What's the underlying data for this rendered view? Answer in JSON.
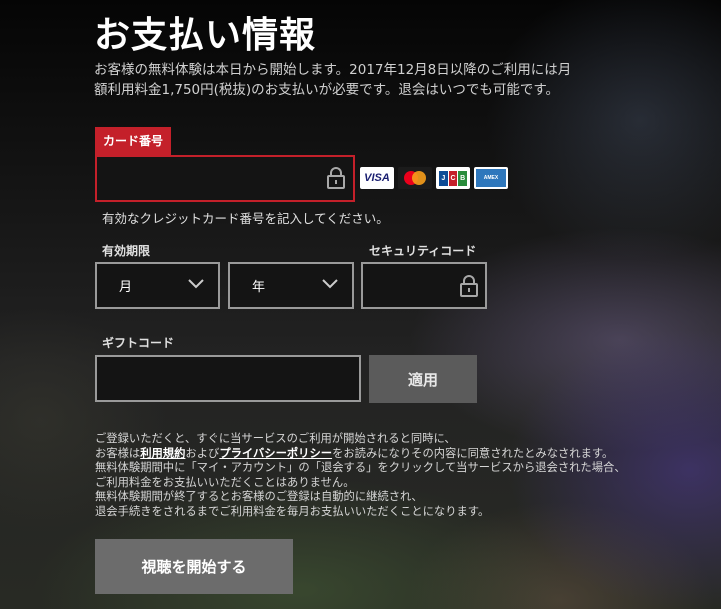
{
  "page": {
    "title": "お支払い情報",
    "intro_line1": "お客様の無料体験は本日から開始します。2017年12月8日以降のご利用には月",
    "intro_line2": "額利用料金1,750円(税抜)のお支払いが必要です。退会はいつでも可能です。"
  },
  "card": {
    "label": "カード番号",
    "value": "",
    "error": "有効なクレジットカード番号を記入してください。",
    "brands": [
      "VISA",
      "mastercard",
      "JCB",
      "AMERICAN EXPRESS"
    ]
  },
  "expiry": {
    "label": "有効期限",
    "month_value": "月",
    "year_value": "年"
  },
  "security": {
    "label": "セキュリティコード",
    "value": ""
  },
  "gift": {
    "label": "ギフトコード",
    "value": "",
    "apply_label": "適用"
  },
  "notice": {
    "line1": "ご登録いただくと、すぐに当サービスのご利用が開始されると同時に、",
    "line2_pre": "お客様は",
    "terms_link": "利用規約",
    "line2_mid": "および",
    "privacy_link": "プライバシーポリシー",
    "line2_post": "をお読みになりその内容に同意されたとみなされます。",
    "line3": "無料体験期間中に「マイ・アカウント」の「退会する」をクリックして当サービスから退会された場合、",
    "line4": "ご利用料金をお支払いいただくことはありません。",
    "line5": "無料体験期間が終了するとお客様のご登録は自動的に継続され、",
    "line6": "退会手続きをされるまでご利用料金を毎月お支払いいただくことになります。"
  },
  "submit": {
    "label": "視聴を開始する"
  },
  "colors": {
    "accent_red": "#c4202a",
    "input_border": "#9a9a9a"
  }
}
